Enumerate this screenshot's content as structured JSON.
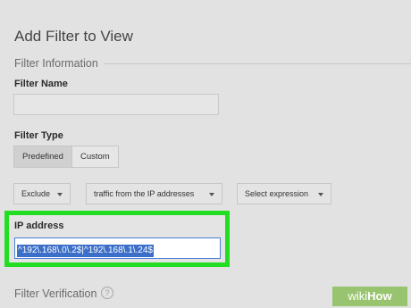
{
  "page_title": "Add Filter to View",
  "filter_information": {
    "header": "Filter Information",
    "filter_name_label": "Filter Name",
    "filter_name_value": ""
  },
  "filter_type": {
    "label": "Filter Type",
    "tabs": [
      {
        "label": "Predefined",
        "active": true
      },
      {
        "label": "Custom",
        "active": false
      }
    ]
  },
  "dropdowns": {
    "action": "Exclude",
    "source": "traffic from the IP addresses",
    "expression": "Select expression"
  },
  "ip_address": {
    "label": "IP address",
    "value": "^192\\.168\\.0\\.2$|^192\\.168\\.1\\.24$"
  },
  "filter_verification": {
    "label": "Filter Verification",
    "help_icon": "question-circle-icon"
  },
  "watermark": {
    "prefix": "wiki",
    "suffix": "How"
  },
  "colors": {
    "background": "#e2e2e2",
    "highlight_border": "#22dd22",
    "selection": "#3c6fc9"
  }
}
